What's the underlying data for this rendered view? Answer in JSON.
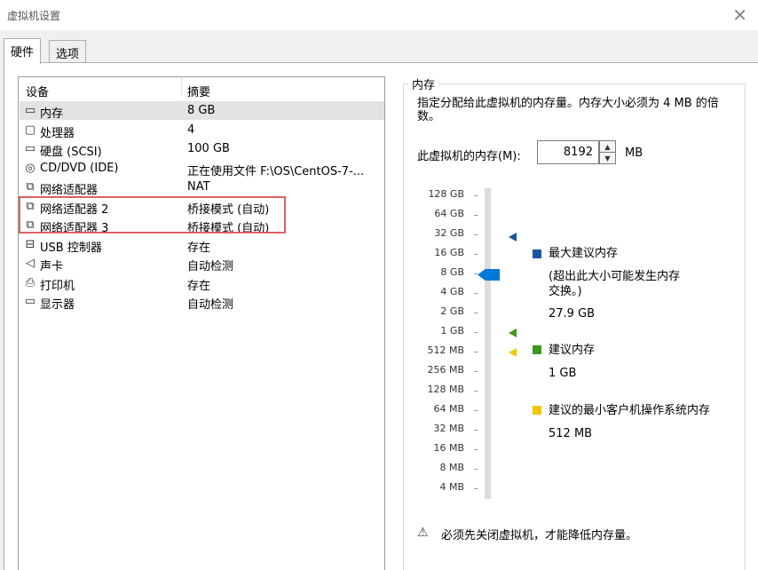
{
  "window": {
    "title": "虚拟机设置",
    "close_glyph": "✕"
  },
  "tabs": [
    {
      "label": "硬件",
      "active": true
    },
    {
      "label": "选项",
      "active": false
    }
  ],
  "device_list": {
    "columns": [
      "设备",
      "摘要"
    ],
    "rows": [
      {
        "name": "内存",
        "summary": "8 GB",
        "icon": "memory-icon",
        "glyph": "▭",
        "selected": true
      },
      {
        "name": "处理器",
        "summary": "4",
        "icon": "cpu-icon",
        "glyph": "▢",
        "selected": false
      },
      {
        "name": "硬盘 (SCSI)",
        "summary": "100 GB",
        "icon": "hard-disk-icon",
        "glyph": "▭",
        "selected": false
      },
      {
        "name": "CD/DVD (IDE)",
        "summary": "正在使用文件 F:\\OS\\CentOS-7-...",
        "icon": "cd-dvd-icon",
        "glyph": "◎",
        "selected": false
      },
      {
        "name": "网络适配器",
        "summary": "NAT",
        "icon": "network-adapter-icon",
        "glyph": "⧉",
        "selected": false
      },
      {
        "name": "网络适配器 2",
        "summary": "桥接模式 (自动)",
        "icon": "network-adapter-icon",
        "glyph": "⧉",
        "selected": false
      },
      {
        "name": "网络适配器 3",
        "summary": "桥接模式 (自动)",
        "icon": "network-adapter-icon",
        "glyph": "⧉",
        "selected": false
      },
      {
        "name": "USB 控制器",
        "summary": "存在",
        "icon": "usb-icon",
        "glyph": "⊟",
        "selected": false
      },
      {
        "name": "声卡",
        "summary": "自动检测",
        "icon": "sound-card-icon",
        "glyph": "◁",
        "selected": false
      },
      {
        "name": "打印机",
        "summary": "存在",
        "icon": "printer-icon",
        "glyph": "⎙",
        "selected": false
      },
      {
        "name": "显示器",
        "summary": "自动检测",
        "icon": "monitor-icon",
        "glyph": "▭",
        "selected": false
      }
    ]
  },
  "memory_panel": {
    "group_label": "内存",
    "description": "指定分配给此虚拟机的内存量。内存大小必须为 4 MB 的倍数。",
    "field_label": "此虚拟机的内存(M):",
    "value": "8192",
    "unit": "MB",
    "slider": {
      "ticks": [
        "128 GB",
        "64 GB",
        "32 GB",
        "16 GB",
        "8 GB",
        "4 GB",
        "2 GB",
        "1 GB",
        "512 MB",
        "256 MB",
        "128 MB",
        "64 MB",
        "32 MB",
        "16 MB",
        "8 MB",
        "4 MB"
      ],
      "current": "8 GB"
    },
    "legend": [
      {
        "label": "最大建议内存",
        "note": "(超出此大小可能发生内存交换。)",
        "value": "27.9 GB",
        "color": "#1a56a0"
      },
      {
        "label": "建议内存",
        "value": "1 GB",
        "color": "#3e9a1e"
      },
      {
        "label": "建议的最小客户机操作系统内存",
        "value": "512 MB",
        "color": "#f0c800"
      }
    ],
    "warning": "必须先关闭虚拟机，才能降低内存量。"
  }
}
